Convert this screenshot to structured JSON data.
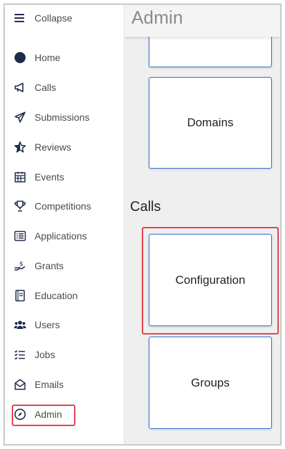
{
  "sidebar": {
    "collapse_label": "Collapse",
    "items": [
      {
        "label": "Home",
        "icon": "home-icon"
      },
      {
        "label": "Calls",
        "icon": "megaphone-icon"
      },
      {
        "label": "Submissions",
        "icon": "paper-plane-icon"
      },
      {
        "label": "Reviews",
        "icon": "star-icon"
      },
      {
        "label": "Events",
        "icon": "calendar-icon"
      },
      {
        "label": "Competitions",
        "icon": "trophy-icon"
      },
      {
        "label": "Applications",
        "icon": "list-box-icon"
      },
      {
        "label": "Grants",
        "icon": "hand-money-icon"
      },
      {
        "label": "Education",
        "icon": "book-icon"
      },
      {
        "label": "Users",
        "icon": "users-icon"
      },
      {
        "label": "Jobs",
        "icon": "checklist-icon"
      },
      {
        "label": "Emails",
        "icon": "envelope-open-icon"
      },
      {
        "label": "Admin",
        "icon": "compass-icon"
      }
    ]
  },
  "main": {
    "title": "Admin",
    "cards_top": [
      "",
      "Domains"
    ],
    "section_title": "Calls",
    "calls_cards": [
      "Configuration",
      "Groups"
    ]
  },
  "colors": {
    "accent_border": "#2e6fd8",
    "highlight": "#e0434b",
    "icon": "#1d2a4a"
  }
}
